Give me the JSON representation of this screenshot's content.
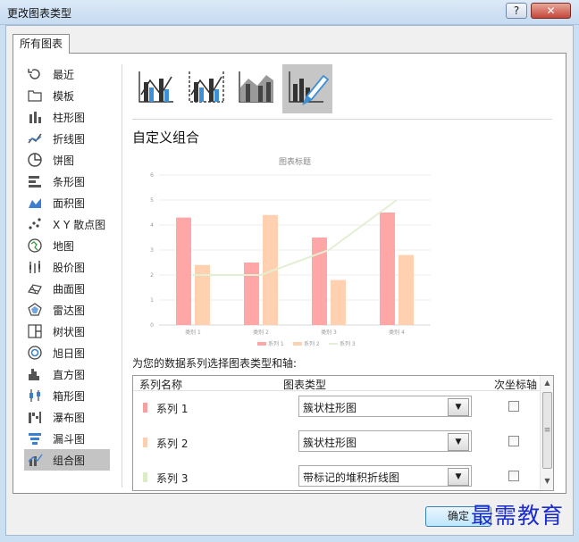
{
  "window": {
    "title": "更改图表类型",
    "help_label": "?",
    "close_label": "✕"
  },
  "tab": {
    "label": "所有图表"
  },
  "sidebar": {
    "items": [
      {
        "label": "最近",
        "icon": "recent-icon"
      },
      {
        "label": "模板",
        "icon": "template-folder-icon"
      },
      {
        "label": "柱形图",
        "icon": "column-chart-icon"
      },
      {
        "label": "折线图",
        "icon": "line-chart-icon"
      },
      {
        "label": "饼图",
        "icon": "pie-chart-icon"
      },
      {
        "label": "条形图",
        "icon": "bar-chart-icon"
      },
      {
        "label": "面积图",
        "icon": "area-chart-icon"
      },
      {
        "label": "X Y 散点图",
        "icon": "scatter-chart-icon"
      },
      {
        "label": "地图",
        "icon": "map-chart-icon"
      },
      {
        "label": "股价图",
        "icon": "stock-chart-icon"
      },
      {
        "label": "曲面图",
        "icon": "surface-chart-icon"
      },
      {
        "label": "雷达图",
        "icon": "radar-chart-icon"
      },
      {
        "label": "树状图",
        "icon": "treemap-chart-icon"
      },
      {
        "label": "旭日图",
        "icon": "sunburst-chart-icon"
      },
      {
        "label": "直方图",
        "icon": "histogram-chart-icon"
      },
      {
        "label": "箱形图",
        "icon": "box-whisker-chart-icon"
      },
      {
        "label": "瀑布图",
        "icon": "waterfall-chart-icon"
      },
      {
        "label": "漏斗图",
        "icon": "funnel-chart-icon"
      },
      {
        "label": "组合图",
        "icon": "combo-chart-icon"
      }
    ],
    "selected_index": 18
  },
  "combo_types": [
    {
      "icon": "clustered-column-line-icon"
    },
    {
      "icon": "clustered-column-line-secondary-axis-icon"
    },
    {
      "icon": "stacked-area-clustered-column-icon"
    },
    {
      "icon": "custom-combination-icon"
    }
  ],
  "combo_selected_index": 3,
  "heading": "自定义组合",
  "chart_data": {
    "type": "bar",
    "title": "图表标题",
    "categories": [
      "类别 1",
      "类别 2",
      "类别 3",
      "类别 4"
    ],
    "series": [
      {
        "name": "系列 1",
        "type": "bar",
        "values": [
          4.3,
          2.5,
          3.5,
          4.5
        ],
        "color": "#ffa6a6"
      },
      {
        "name": "系列 2",
        "type": "bar",
        "values": [
          2.4,
          4.4,
          1.8,
          2.8
        ],
        "color": "#ffd1b1"
      },
      {
        "name": "系列 3",
        "type": "line",
        "values": [
          2,
          2,
          3,
          5
        ],
        "color": "#e2efd3"
      }
    ],
    "ylim": [
      0,
      6
    ],
    "yticks": [
      "0",
      "1",
      "2",
      "3",
      "4",
      "5",
      "6"
    ],
    "grid": true,
    "legend": "bottom"
  },
  "prompt": "为您的数据系列选择图表类型和轴:",
  "table": {
    "headers": {
      "name": "系列名称",
      "type": "图表类型",
      "secondary": "次坐标轴"
    },
    "rows": [
      {
        "name": "系列 1",
        "swatch": "#f3a0a0",
        "type": "簇状柱形图",
        "secondary": false
      },
      {
        "name": "系列 2",
        "swatch": "#fbd0b2",
        "type": "簇状柱形图",
        "secondary": false
      },
      {
        "name": "系列 3",
        "swatch": "#dcebc8",
        "type": "带标记的堆积折线图",
        "secondary": false
      }
    ]
  },
  "buttons": {
    "ok": "确定"
  },
  "watermark": "最需教育"
}
